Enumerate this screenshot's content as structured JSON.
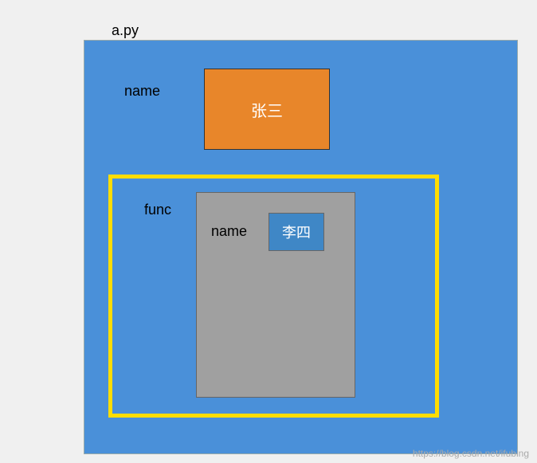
{
  "filename": "a.py",
  "outer": {
    "varLabel": "name",
    "varValue": "张三"
  },
  "inner": {
    "funcLabel": "func",
    "varLabel": "name",
    "varValue": "李四"
  },
  "watermark": "https://blog.csdn.net/ifubing"
}
